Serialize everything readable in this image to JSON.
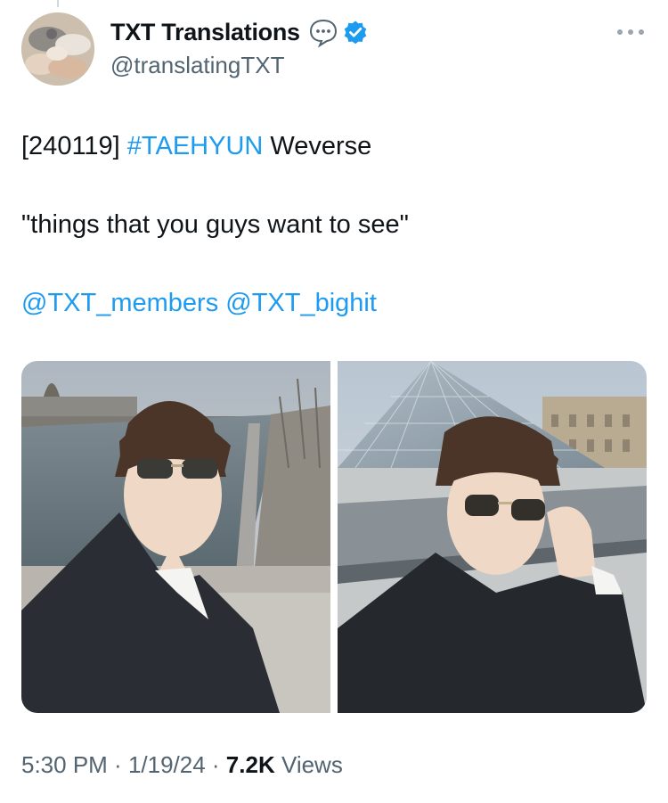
{
  "tweet": {
    "author": {
      "display_name": "TXT Translations",
      "handle": "@translatingTXT",
      "badges": [
        "speech-bubble-icon",
        "verified-badge-icon"
      ],
      "verified_color": "#1d9bf0"
    },
    "more_icon": "more-horizontal-icon",
    "text": {
      "line1_prefix": "[240119] ",
      "hashtag": "#TAEHYUN",
      "line1_suffix": " Weverse",
      "quote": "\"things that you guys want to see\"",
      "mention1": "@TXT_members",
      "mention2": "@TXT_bighit"
    },
    "media": [
      {
        "type": "photo",
        "icon": "photo-seine-river"
      },
      {
        "type": "photo",
        "icon": "photo-louvre-pyramid"
      }
    ],
    "meta": {
      "time": "5:30 PM",
      "separator": " · ",
      "date": "1/19/24",
      "views_count": "7.2K",
      "views_label": "Views"
    }
  },
  "colors": {
    "link": "#1d9bf0",
    "secondary_text": "#536471",
    "primary_text": "#0f1419"
  }
}
